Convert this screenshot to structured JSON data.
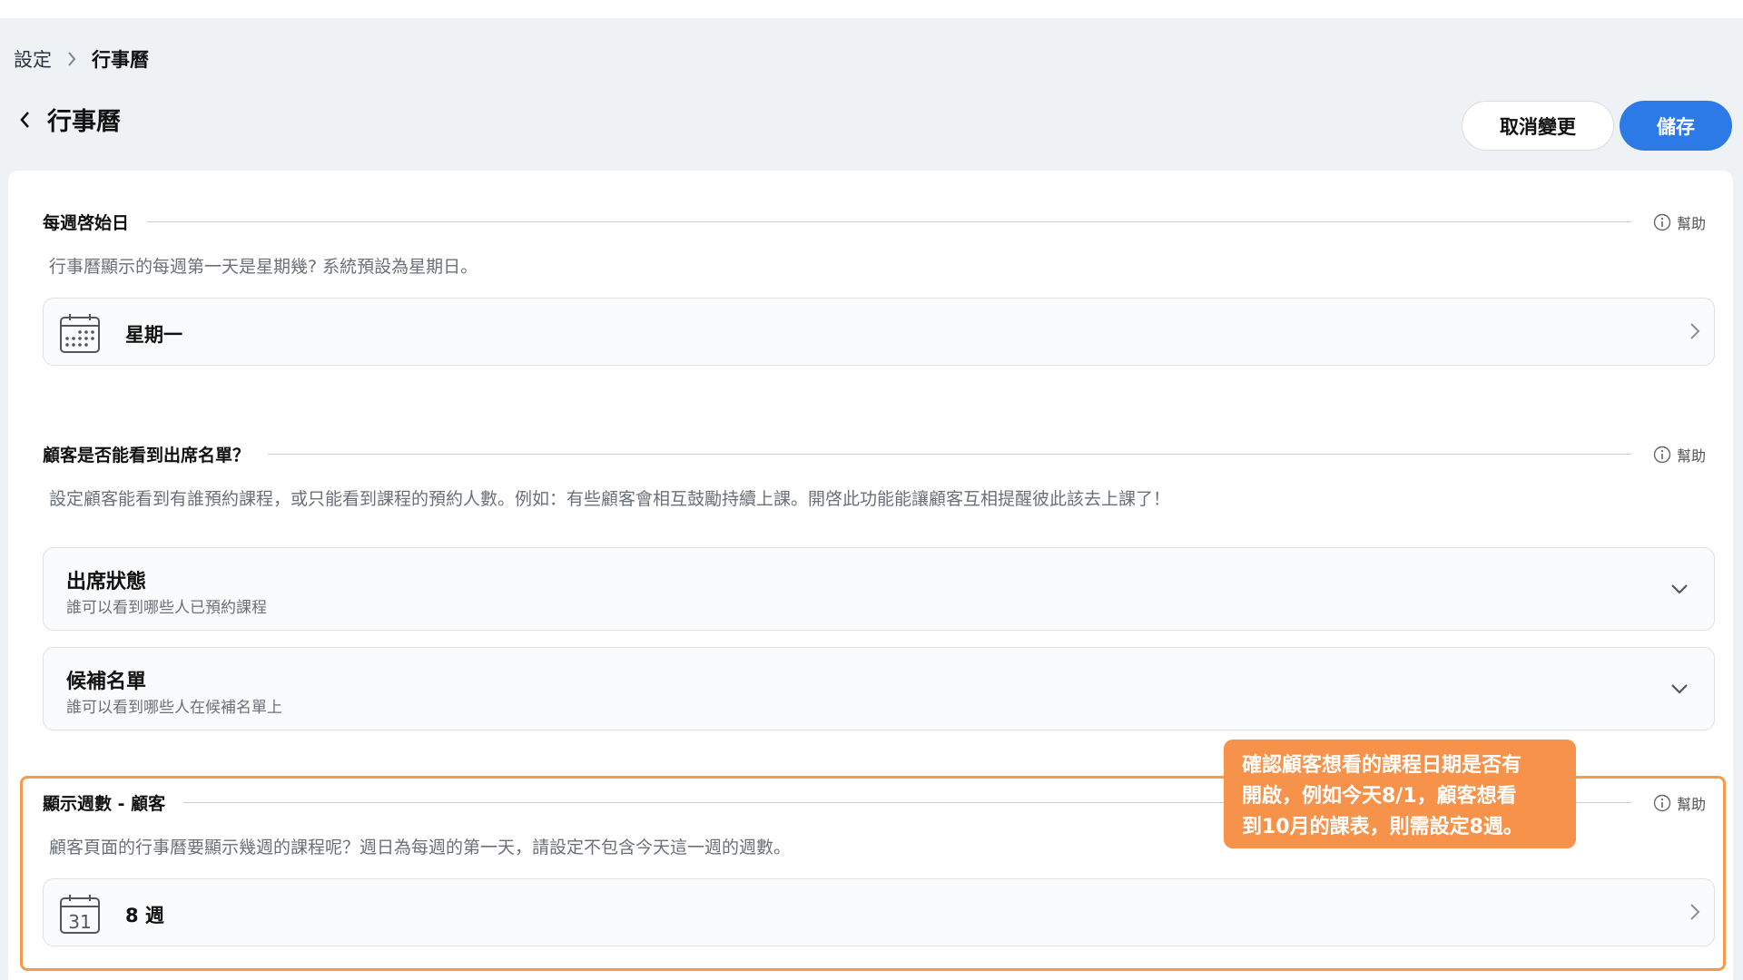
{
  "breadcrumb": {
    "parent": "設定",
    "current": "行事曆"
  },
  "header": {
    "title": "行事曆",
    "cancel_label": "取消變更",
    "save_label": "儲存"
  },
  "help_label": "幫助",
  "week_start": {
    "title": "每週啓始日",
    "description": "行事曆顯示的每週第一天是星期幾? 系統預設為星期日。",
    "value": "星期一",
    "icon": "calendar-grid-icon"
  },
  "attendance": {
    "title": "顧客是否能看到出席名單？",
    "description": "設定顧客能看到有誰預約課程，或只能看到課程的預約人數。例如：有些顧客會相互鼓勵持續上課。開啓此功能能讓顧客互相提醒彼此該去上課了！",
    "items": [
      {
        "title": "出席狀態",
        "subtitle": "誰可以看到哪些人已預約課程"
      },
      {
        "title": "候補名單",
        "subtitle": "誰可以看到哪些人在候補名單上"
      }
    ]
  },
  "display_weeks": {
    "title": "顯示週數 - 顧客",
    "description": "顧客頁面的行事曆要顯示幾週的課程呢？週日為每週的第一天，請設定不包含今天這一週的週數。",
    "value": "8 週",
    "icon_day": "31",
    "icon": "calendar-31-icon"
  },
  "callout": {
    "lines": [
      "確認顧客想看的課程日期是否有",
      "開啟，例如今天8/1，顧客想看",
      "到10月的課表，則需設定8週。"
    ]
  },
  "colors": {
    "accent": "#2b7ae6",
    "highlight": "#f79a4c",
    "callout_bg": "#f7924b"
  }
}
